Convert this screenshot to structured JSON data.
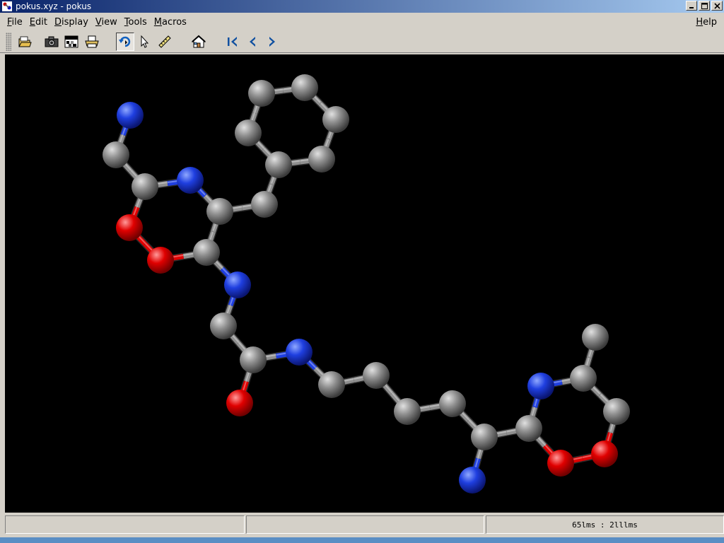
{
  "window": {
    "title": "pokus.xyz - pokus",
    "icon": "jmol-molecule-icon",
    "controls": [
      "minimize",
      "maximize",
      "close"
    ]
  },
  "menubar": {
    "items": [
      "File",
      "Edit",
      "Display",
      "View",
      "Tools",
      "Macros"
    ],
    "help": "Help"
  },
  "toolbar": {
    "buttons": [
      {
        "icon": "open-folder-icon"
      },
      {
        "icon": "camera-icon"
      },
      {
        "icon": "export-image-icon"
      },
      {
        "icon": "print-icon"
      },
      {
        "icon": "rotate-icon",
        "pressed": true
      },
      {
        "icon": "pick-arrow-icon"
      },
      {
        "icon": "ruler-icon"
      },
      {
        "icon": "home-icon"
      },
      {
        "icon": "first-frame-icon"
      },
      {
        "icon": "previous-frame-icon"
      },
      {
        "icon": "next-frame-icon"
      }
    ]
  },
  "colors": {
    "carbon": "#8f8f8f",
    "nitrogen": "#1f3fe0",
    "oxygen": "#e00000",
    "background": "#000000"
  },
  "statusbar": {
    "cell1": "",
    "cell2": "",
    "cell3": "65lms : 2lllms"
  }
}
